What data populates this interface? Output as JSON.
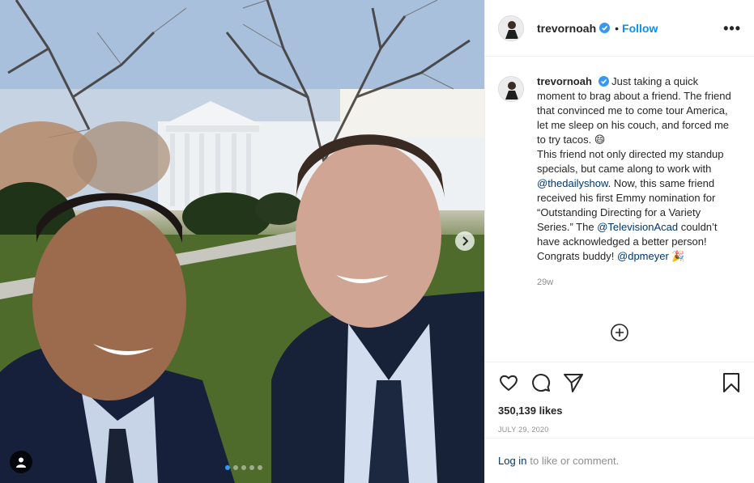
{
  "post": {
    "username": "trevornoah",
    "follow_label": "Follow",
    "bullet": "•",
    "more_label": "•••",
    "caption_parts": {
      "p1": "Just taking a quick moment to brag about a friend. The friend that convinced me to come tour America, let me sleep on his couch, and forced me to try tacos. 😄",
      "p2": "This friend not only directed my standup specials, but came along to work with ",
      "mention1": "@thedailyshow",
      "p3": ". Now, this same friend received his first Emmy nomination for “Outstanding Directing for a Variety Series.” The ",
      "mention2": "@TelevisionAcad",
      "p4": " couldn’t have acknowledged a better person! Congrats buddy! ",
      "mention3": "@dpmeyer",
      "p5": " 🎉"
    },
    "time_ago": "29w",
    "likes": "350,139 likes",
    "date": "JULY 29, 2020",
    "login_link": "Log in",
    "login_rest": "to like or comment."
  },
  "carousel": {
    "count": 5,
    "active_index": 0
  },
  "colors": {
    "accent": "#0095f6",
    "mention": "#00376b",
    "muted": "#8e8e8e",
    "verified": "#3897f0"
  },
  "icons": [
    "user-tag-icon",
    "chevron-right-icon",
    "verified-icon",
    "more-icon",
    "add-comment-icon",
    "heart-icon",
    "comment-icon",
    "share-icon",
    "bookmark-icon"
  ]
}
